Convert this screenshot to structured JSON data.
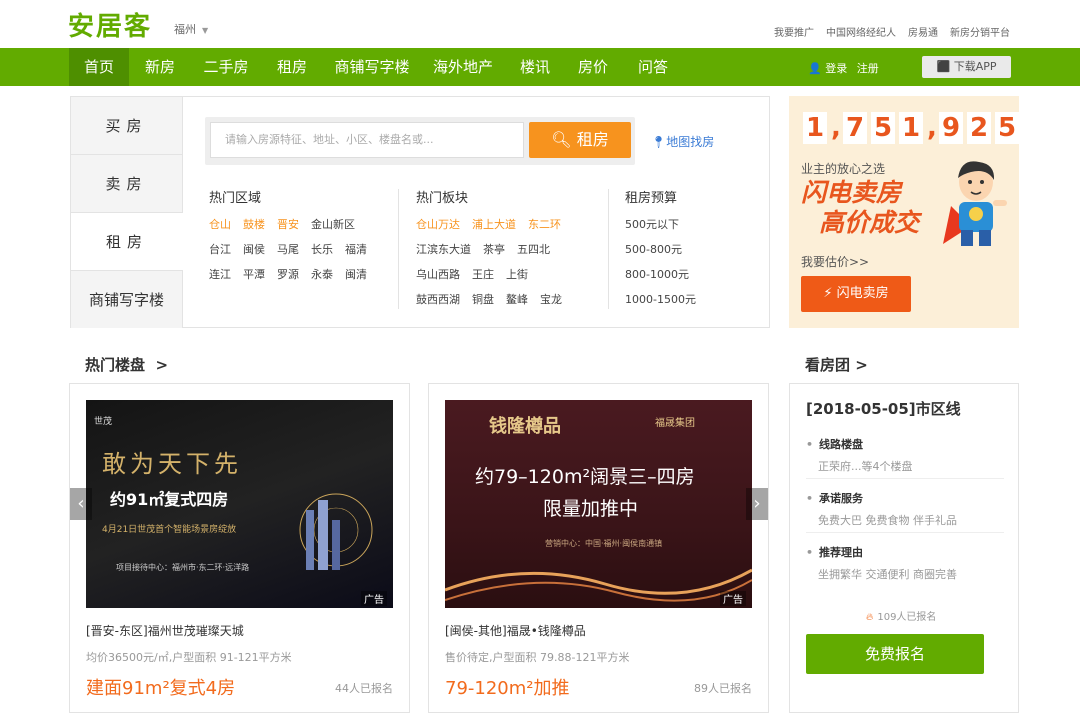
{
  "header": {
    "logo": "安居客",
    "city": "福州",
    "links": [
      "我要推广",
      "中国网络经纪人",
      "房易通",
      "新房分销平台"
    ]
  },
  "nav": {
    "items": [
      "首页",
      "新房",
      "二手房",
      "租房",
      "商铺写字楼",
      "海外地产",
      "楼讯",
      "房价",
      "问答"
    ],
    "active_index": 0,
    "login": "登录",
    "register": "注册",
    "download": "下载APP"
  },
  "search": {
    "tabs": [
      "买房",
      "卖房",
      "租房",
      "商铺写字楼"
    ],
    "active_tab": 2,
    "placeholder": "请输入房源特征、地址、小区、楼盘名或...",
    "button": "租房",
    "map_link": "地图找房",
    "hot_areas": {
      "title": "热门区域",
      "rows": [
        [
          {
            "t": "仓山",
            "hot": true
          },
          {
            "t": "鼓楼",
            "hot": true
          },
          {
            "t": "晋安",
            "hot": true
          },
          {
            "t": "金山新区",
            "hot": false
          }
        ],
        [
          {
            "t": "台江",
            "hot": false
          },
          {
            "t": "闽侯",
            "hot": false
          },
          {
            "t": "马尾",
            "hot": false
          },
          {
            "t": "长乐",
            "hot": false
          },
          {
            "t": "福清",
            "hot": false
          }
        ],
        [
          {
            "t": "连江",
            "hot": false
          },
          {
            "t": "平潭",
            "hot": false
          },
          {
            "t": "罗源",
            "hot": false
          },
          {
            "t": "永泰",
            "hot": false
          },
          {
            "t": "闽清",
            "hot": false
          }
        ]
      ]
    },
    "hot_blocks": {
      "title": "热门板块",
      "rows": [
        [
          {
            "t": "仓山万达",
            "hot": true
          },
          {
            "t": "浦上大道",
            "hot": true
          },
          {
            "t": "东二环",
            "hot": true
          }
        ],
        [
          {
            "t": "江滨东大道",
            "hot": false
          },
          {
            "t": "茶亭",
            "hot": false
          },
          {
            "t": "五四北",
            "hot": false
          }
        ],
        [
          {
            "t": "乌山西路",
            "hot": false
          },
          {
            "t": "王庄",
            "hot": false
          },
          {
            "t": "上街",
            "hot": false
          }
        ],
        [
          {
            "t": "鼓西西湖",
            "hot": false
          },
          {
            "t": "铜盘",
            "hot": false
          },
          {
            "t": "鳌峰",
            "hot": false
          },
          {
            "t": "宝龙",
            "hot": false
          }
        ]
      ]
    },
    "budget": {
      "title": "租房预算",
      "rows": [
        "500元以下",
        "500-800元",
        "800-1000元",
        "1000-1500元"
      ]
    }
  },
  "promo": {
    "digits": [
      "1",
      ",",
      "7",
      "5",
      "1",
      ",",
      "9",
      "2",
      "5"
    ],
    "subtitle": "业主的放心之选",
    "line1": "闪电卖房",
    "line2": "高价成交",
    "estimate": "我要估价>>",
    "button": "闪电卖房"
  },
  "hot_section": {
    "title": "热门楼盘",
    "arrow": ">"
  },
  "tour_section": {
    "title": "看房团",
    "arrow": ">"
  },
  "cards": [
    {
      "img_head": "敢为天下先",
      "img_main": "约91㎡复式四房",
      "img_small": "4月21日世茂首个智能场景房绽放",
      "img_foot": "项目接待中心：福州市·东二环·远洋路",
      "brand_left": "世茂",
      "ad": "广告",
      "name": "[晋安-东区]福州世茂璀璨天城",
      "meta": "均价36500元/㎡,户型面积 91-121平方米",
      "highlight": "建面91m²复式4房",
      "count": "44人已报名"
    },
    {
      "img_head": "钱隆樽品",
      "img_main": "约79–120m²阔景三–四房",
      "img_small": "限量加推中",
      "img_foot": "营销中心：中国·福州·闽侯南通镇",
      "brand_left": "福晟集团",
      "ad": "广告",
      "name": "[闽侯-其他]福晟•钱隆樽品",
      "meta": "售价待定,户型面积 79.88-121平方米",
      "highlight": "79-120m²加推",
      "count": "89人已报名"
    }
  ],
  "tour": {
    "title": "[2018-05-05]市区线",
    "sections": [
      {
        "k": "线路楼盘",
        "v": "正荣府...等4个楼盘"
      },
      {
        "k": "承诺服务",
        "v": "免费大巴 免费食物 伴手礼品"
      },
      {
        "k": "推荐理由",
        "v": "坐拥繁华 交通便利 商圈完善"
      }
    ],
    "joined": "109人已报名",
    "button": "免费报名"
  },
  "colors": {
    "green": "#62ab00",
    "orange": "#f7931e",
    "red": "#ef5a17"
  }
}
